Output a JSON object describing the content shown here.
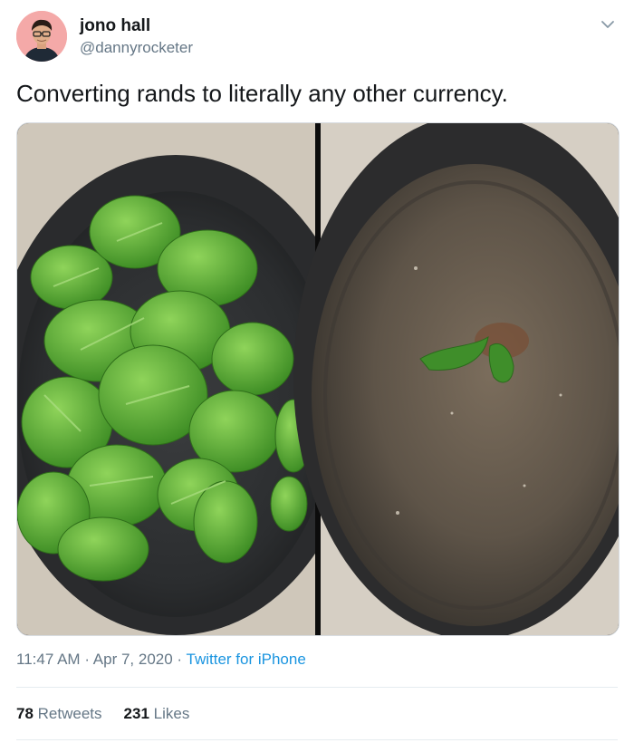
{
  "author": {
    "name": "jono hall",
    "handle": "@dannyrocketer"
  },
  "tweet": {
    "text": "Converting rands to literally any other currency.",
    "time": "11:47 AM",
    "date": "Apr 7, 2020",
    "source": "Twitter for iPhone",
    "separator": "·"
  },
  "stats": {
    "retweets_count": "78",
    "retweets_label": "Retweets",
    "likes_count": "231",
    "likes_label": "Likes"
  },
  "colors": {
    "link": "#1b95e0",
    "secondary_text": "#657786",
    "avatar_bg": "#f4a9a8"
  },
  "icons": {
    "menu": "chevron-down-icon"
  }
}
